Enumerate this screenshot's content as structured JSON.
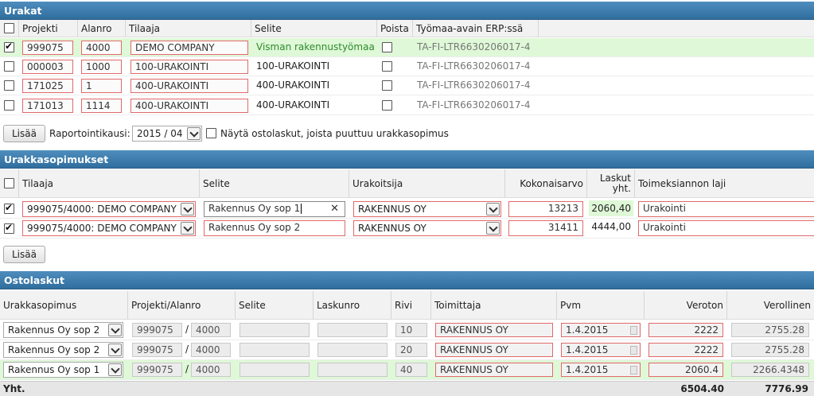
{
  "urakat": {
    "title": "Urakat",
    "columns": [
      "Projekti",
      "Alanro",
      "Tilaaja",
      "Selite",
      "Poista",
      "Työmaa-avain ERP:ssä"
    ],
    "rows": [
      {
        "projekti": "999075",
        "alanro": "4000",
        "tilaaja": "DEMO COMPANY",
        "selite": "Visman rakennustyömaa",
        "avain": "TA-FI-LTR6630206017-4"
      },
      {
        "projekti": "000003",
        "alanro": "1000",
        "tilaaja": "100-URAKOINTI",
        "selite": "100-URAKOINTI",
        "avain": "TA-FI-LTR6630206017-4"
      },
      {
        "projekti": "171025",
        "alanro": "1",
        "tilaaja": "400-URAKOINTI",
        "selite": "400-URAKOINTI",
        "avain": "TA-FI-LTR6630206017-4"
      },
      {
        "projekti": "171013",
        "alanro": "1114",
        "tilaaja": "400-URAKOINTI",
        "selite": "400-URAKOINTI",
        "avain": "TA-FI-LTR6630206017-4"
      }
    ],
    "add_label": "Lisää",
    "period_label": "Raportointikausi:",
    "period_value": "2015 / 04",
    "missing_label": "Näytä ostolaskut, joista puuttuu urakkasopimus"
  },
  "sopimukset": {
    "title": "Urakkasopimukset",
    "columns": {
      "tilaaja": "Tilaaja",
      "selite": "Selite",
      "urakoitsija": "Urakoitsija",
      "kokonaisarvo": "Kokonaisarvo",
      "laskut_1": "Laskut",
      "laskut_2": "yht.",
      "laji": "Toimeksiannon laji"
    },
    "rows": [
      {
        "tilaaja": "999075/4000: DEMO COMPANY",
        "selite": "Rakennus Oy sop 1",
        "urakoitsija": "RAKENNUS OY",
        "kokonaisarvo": "13213",
        "laskut": "2060,40",
        "laji": "Urakointi"
      },
      {
        "tilaaja": "999075/4000: DEMO COMPANY",
        "selite": "Rakennus Oy sop 2",
        "urakoitsija": "RAKENNUS OY",
        "kokonaisarvo": "31411",
        "laskut": "4444,00",
        "laji": "Urakointi"
      }
    ],
    "add_label": "Lisää"
  },
  "ostolaskut": {
    "title": "Ostolaskut",
    "columns": {
      "sopimus": "Urakkasopimus",
      "projekti": "Projekti/Alanro",
      "selite": "Selite",
      "laskunro": "Laskunro",
      "rivi": "Rivi",
      "toimittaja": "Toimittaja",
      "pvm": "Pvm",
      "veroton": "Veroton",
      "verollinen": "Verollinen"
    },
    "rows": [
      {
        "sopimus": "Rakennus Oy sop 2",
        "projekti": "999075",
        "slash": "/",
        "alanro": "4000",
        "rivi": "10",
        "toimittaja": "RAKENNUS OY",
        "pvm": "1.4.2015",
        "veroton": "2222",
        "verollinen": "2755.28"
      },
      {
        "sopimus": "Rakennus Oy sop 2",
        "projekti": "999075",
        "slash": "/",
        "alanro": "4000",
        "rivi": "20",
        "toimittaja": "RAKENNUS OY",
        "pvm": "1.4.2015",
        "veroton": "2222",
        "verollinen": "2755.28"
      },
      {
        "sopimus": "Rakennus Oy sop 1",
        "projekti": "999075",
        "slash": "/",
        "alanro": "4000",
        "rivi": "40",
        "toimittaja": "RAKENNUS OY",
        "pvm": "1.4.2015",
        "veroton": "2060.4",
        "verollinen": "2266.4348"
      }
    ],
    "total_label": "Yht.",
    "total_veroton": "6504.40",
    "total_verollinen": "7776.99"
  },
  "colors": {
    "header_blue": "#3a7bab",
    "selected_row_green": "#dff8d7",
    "error_border_red": "#e06a6a",
    "selite_green": "#2d8a2d"
  }
}
